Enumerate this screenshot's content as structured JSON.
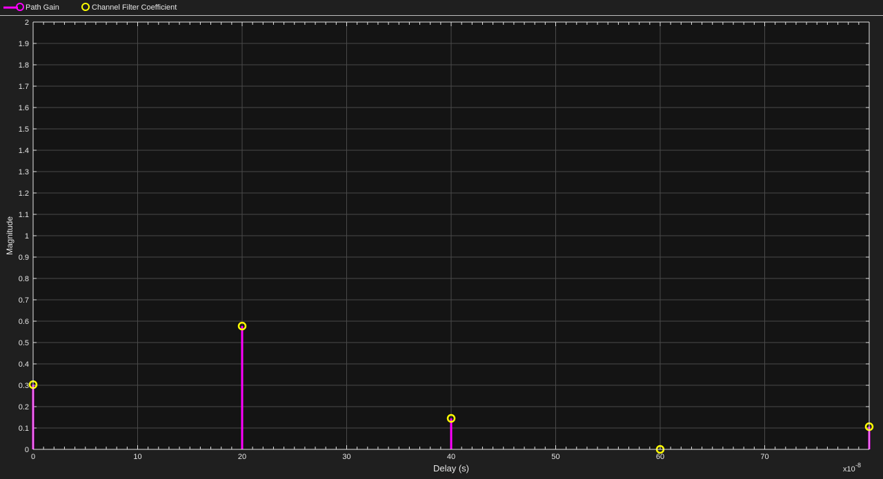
{
  "legend": [
    {
      "label": "Path Gain",
      "color": "#ff00ff",
      "icon": "stem-marker-icon"
    },
    {
      "label": "Channel Filter Coefficient",
      "color": "#ffff00",
      "icon": "circle-marker-icon"
    }
  ],
  "chart_data": {
    "type": "stem",
    "xlabel": "Delay (s)",
    "ylabel": "Magnitude",
    "x_exponent_label": "x10",
    "x_exponent": "-8",
    "xlim": [
      0,
      80
    ],
    "ylim": [
      0,
      2
    ],
    "xticks": [
      "0",
      "10",
      "20",
      "30",
      "40",
      "50",
      "60",
      "70"
    ],
    "yticks": [
      "0",
      "0.1",
      "0.2",
      "0.3",
      "0.4",
      "0.5",
      "0.6",
      "0.7",
      "0.8",
      "0.9",
      "1",
      "1.1",
      "1.2",
      "1.3",
      "1.4",
      "1.5",
      "1.6",
      "1.7",
      "1.8",
      "1.9",
      "2"
    ],
    "grid": true,
    "legend_position": "top",
    "series": [
      {
        "name": "Path Gain",
        "x": [
          0,
          20,
          40,
          60,
          80
        ],
        "y": [
          0.303,
          0.577,
          0.145,
          0.0,
          0.106
        ]
      },
      {
        "name": "Channel Filter Coefficient",
        "x": [
          0,
          20,
          40,
          60,
          80
        ],
        "y": [
          0.303,
          0.577,
          0.145,
          0.0,
          0.106
        ]
      }
    ],
    "colors": {
      "path_gain": "#ff00ff",
      "filter": "#ffff00",
      "plot_bg": "#141414",
      "grid": "#4a4a4a"
    }
  }
}
